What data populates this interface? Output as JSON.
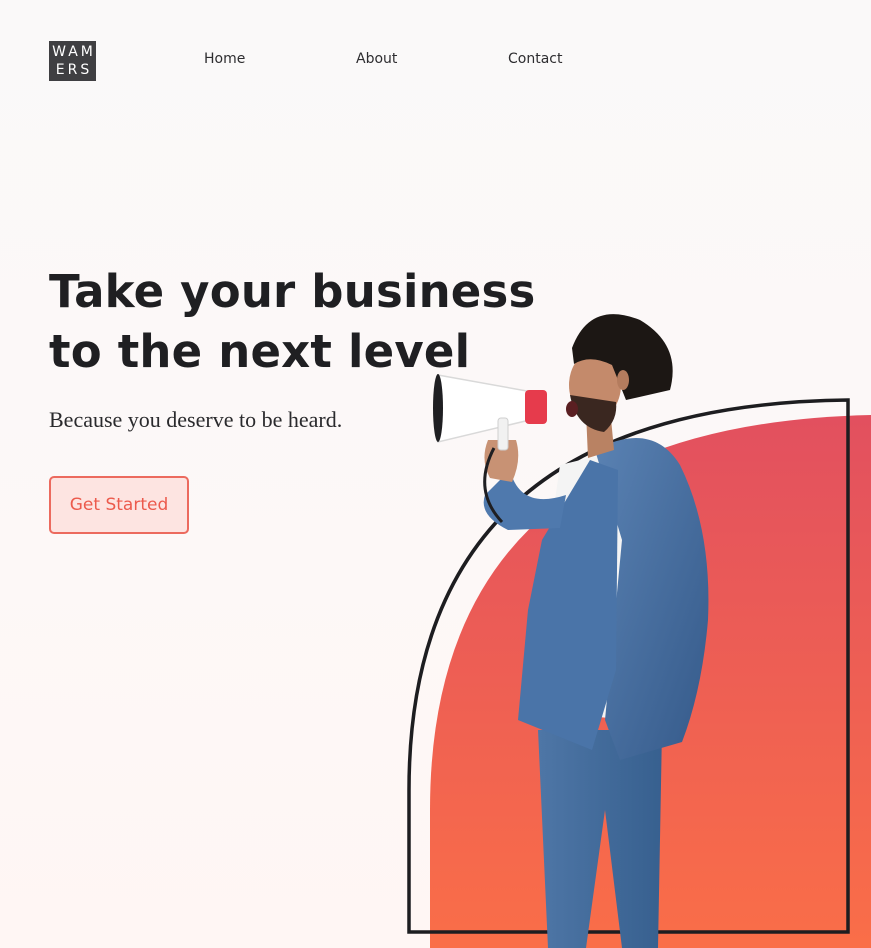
{
  "header": {
    "logo": {
      "line1": "WAM",
      "line2": "ERS"
    },
    "nav": [
      {
        "label": "Home"
      },
      {
        "label": "About"
      },
      {
        "label": "Contact"
      }
    ]
  },
  "hero": {
    "title_line1": "Take your business",
    "title_line2": "to the next level",
    "subtitle": "Because you deserve to be heard.",
    "cta_label": "Get Started"
  },
  "colors": {
    "accent": "#ec5a4c",
    "accent_light": "#fde4e1",
    "gradient_top": "#e2505f",
    "gradient_bottom": "#fa6e48",
    "text_dark": "#1f1f22",
    "logo_bg": "#3f3f42"
  },
  "icons": [
    "megaphone-icon"
  ]
}
